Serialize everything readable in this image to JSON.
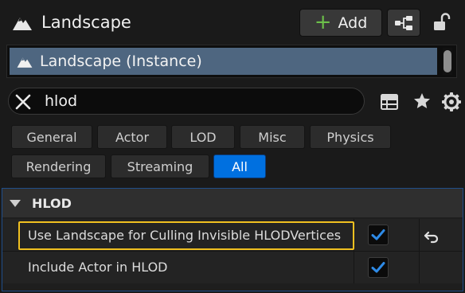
{
  "header": {
    "title": "Landscape",
    "add_label": "Add",
    "icon": "landscape-icon",
    "blueprint_icon": "blueprint-icon",
    "lock_icon": "lock-icon"
  },
  "instance": {
    "label": "Landscape (Instance)",
    "icon": "landscape-icon"
  },
  "search": {
    "value": "hlod",
    "clear_icon": "clear-icon",
    "table_icon": "table-icon",
    "favorite_icon": "star-icon",
    "settings_icon": "gear-icon"
  },
  "categories": [
    {
      "label": "General",
      "active": false
    },
    {
      "label": "Actor",
      "active": false
    },
    {
      "label": "LOD",
      "active": false
    },
    {
      "label": "Misc",
      "active": false
    },
    {
      "label": "Physics",
      "active": false
    },
    {
      "label": "Rendering",
      "active": false
    },
    {
      "label": "Streaming",
      "active": false
    },
    {
      "label": "All",
      "active": true
    }
  ],
  "section": {
    "title": "HLOD",
    "properties": [
      {
        "label": "Use Landscape for Culling Invisible HLODVertices",
        "checked": true,
        "highlighted": true,
        "reset_icon": "reset-arrow-icon"
      },
      {
        "label": "Include Actor in HLOD",
        "checked": true,
        "highlighted": false
      }
    ]
  },
  "colors": {
    "accent": "#0070e0",
    "selection": "#4e6680",
    "highlight": "#f0c020",
    "add_plus": "#6cc04a",
    "check": "#2e8ae6"
  }
}
